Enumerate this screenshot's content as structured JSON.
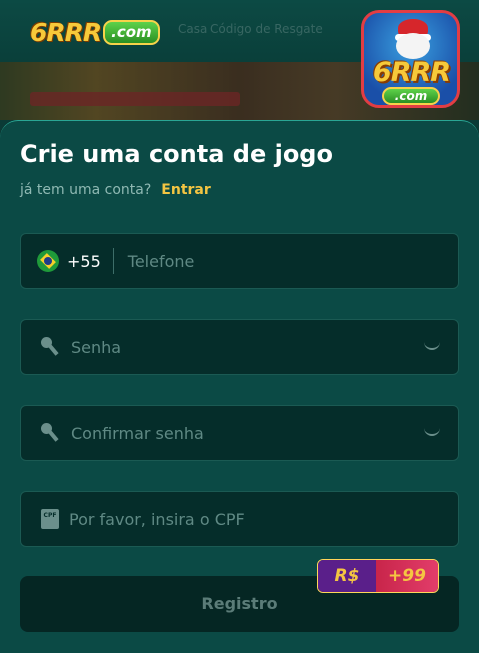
{
  "header": {
    "logo_brand": "6RRR",
    "logo_domain": ".com",
    "nav_faint_1": "Casa",
    "nav_faint_2": "Código de Resgate"
  },
  "app_logo": {
    "brand": "6RRR",
    "domain": ".com"
  },
  "form": {
    "title": "Crie uma conta de jogo",
    "subtitle": "já tem uma conta?",
    "login_link": "Entrar",
    "phone": {
      "country_code": "+55",
      "placeholder": "Telefone",
      "flag_icon": "brazil-flag-icon"
    },
    "password": {
      "placeholder": "Senha",
      "icon": "key-icon",
      "toggle_icon": "eye-closed-icon"
    },
    "confirm_password": {
      "placeholder": "Confirmar senha",
      "icon": "key-icon",
      "toggle_icon": "eye-closed-icon"
    },
    "cpf": {
      "placeholder": "Por favor, insira o CPF",
      "icon": "cpf-card-icon",
      "icon_text": "CPF"
    },
    "submit_label": "Registro"
  },
  "bonus": {
    "currency": "R$",
    "amount": "+99"
  },
  "colors": {
    "background": "#0b4a45",
    "accent": "#f4c542",
    "field_bg": "#052d2a"
  }
}
